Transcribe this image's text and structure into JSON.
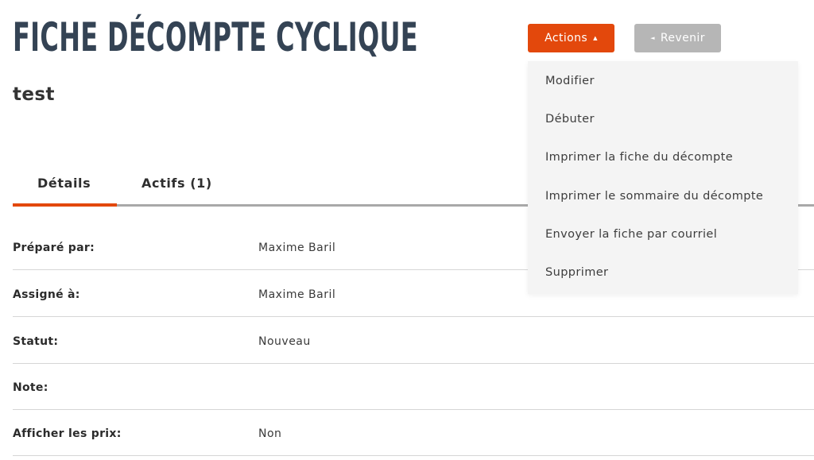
{
  "header": {
    "title": "FICHE DÉCOMPTE CYCLIQUE",
    "actions_label": "Actions",
    "actions_caret": "▲",
    "back_caret": "◄",
    "back_label": "Revenir"
  },
  "actions_menu": {
    "items": [
      "Modifier",
      "Débuter",
      "Imprimer la fiche du décompte",
      "Imprimer le sommaire du décompte",
      "Envoyer la fiche par courriel",
      "Supprimer"
    ]
  },
  "record": {
    "name": "test"
  },
  "tabs": [
    {
      "label": "Détails",
      "active": true
    },
    {
      "label": "Actifs (1)",
      "active": false
    }
  ],
  "details": {
    "rows": [
      {
        "label": "Préparé par:",
        "value": "Maxime Baril"
      },
      {
        "label": "Assigné à:",
        "value": "Maxime Baril"
      },
      {
        "label": "Statut:",
        "value": "Nouveau"
      },
      {
        "label": "Note:",
        "value": ""
      },
      {
        "label": "Afficher les prix:",
        "value": "Non"
      }
    ]
  },
  "colors": {
    "accent": "#e3480c",
    "title": "#344354",
    "secondary_button": "#b6b6b6",
    "menu_background": "#f4f4f4"
  }
}
